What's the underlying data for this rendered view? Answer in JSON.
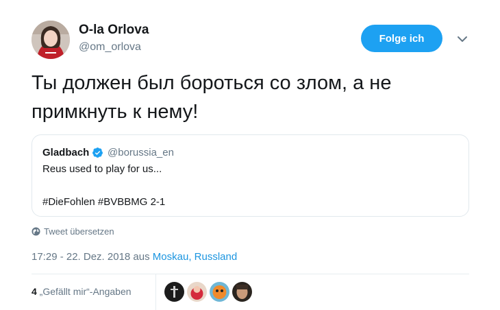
{
  "author": {
    "name": "O-la Orlova",
    "handle": "@om_orlova"
  },
  "actions": {
    "follow_label": "Folge ich"
  },
  "tweet": {
    "lines": [
      "Ты должен был бороться со злом, а не",
      "примкнуть к нему!"
    ]
  },
  "quoted": {
    "name": "Gladbach",
    "handle": "@borussia_en",
    "lines": [
      "Reus used to play for us...",
      "#DieFohlen #BVBBMG 2-1"
    ]
  },
  "translate_label": "Tweet übersetzen",
  "meta": {
    "time_date": "17:29 - 22. Dez. 2018 aus ",
    "location": "Moskau, Russland"
  },
  "likes": {
    "count": "4",
    "label": " „Gefällt mir“-Angaben"
  },
  "colors": {
    "accent": "#1da1f2",
    "link": "#1b95e0",
    "muted": "#657786",
    "border": "#e1e8ed"
  }
}
